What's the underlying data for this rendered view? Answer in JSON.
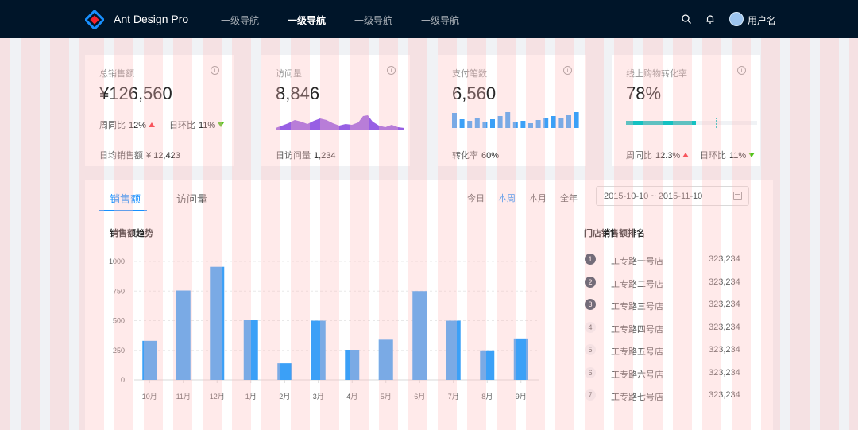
{
  "header": {
    "brand": "Ant Design Pro",
    "nav": [
      {
        "label": "一级导航",
        "active": false
      },
      {
        "label": "一级导航",
        "active": true
      },
      {
        "label": "一级导航",
        "active": false
      },
      {
        "label": "一级导航",
        "active": false
      }
    ],
    "username": "用户名"
  },
  "cards": [
    {
      "title": "总销售额",
      "value": "¥126,560",
      "trend1_label": "周同比",
      "trend1_value": "12%",
      "trend2_label": "日环比",
      "trend2_value": "11%",
      "footer_label": "日均销售额",
      "footer_value": "¥ 12,423"
    },
    {
      "title": "访问量",
      "value": "8,846",
      "footer_label": "日访问量",
      "footer_value": "1,234"
    },
    {
      "title": "支付笔数",
      "value": "6,560",
      "footer_label": "转化率",
      "footer_value": "60%"
    },
    {
      "title": "线上购物转化率",
      "value": "78%",
      "progress": 0.78,
      "trend1_label": "周同比",
      "trend1_value": "12.3%",
      "trend2_label": "日环比",
      "trend2_value": "11%"
    }
  ],
  "tabs": [
    "销售额",
    "访问量"
  ],
  "ranges": [
    "今日",
    "本周",
    "本月",
    "全年"
  ],
  "active_range": "本周",
  "date_range": "2015-10-10 ~ 2015-11-10",
  "chart_data": {
    "type": "bar",
    "title": "销售额趋势",
    "categories": [
      "10月",
      "11月",
      "12月",
      "1月",
      "2月",
      "3月",
      "4月",
      "5月",
      "6月",
      "7月",
      "8月",
      "9月"
    ],
    "values": [
      330,
      755,
      955,
      505,
      140,
      500,
      255,
      340,
      750,
      500,
      250,
      350
    ],
    "ylim": [
      0,
      1000
    ],
    "yticks": [
      0,
      250,
      500,
      750,
      1000
    ],
    "grid": true,
    "color": "#3ba0f7"
  },
  "ranking": {
    "title": "门店销售额排名",
    "items": [
      {
        "rank": "1",
        "name": "工专路一号店",
        "value": "323,234"
      },
      {
        "rank": "2",
        "name": "工专路二号店",
        "value": "323,234"
      },
      {
        "rank": "3",
        "name": "工专路三号店",
        "value": "323,234"
      },
      {
        "rank": "4",
        "name": "工专路四号店",
        "value": "323,234"
      },
      {
        "rank": "5",
        "name": "工专路五号店",
        "value": "323,234"
      },
      {
        "rank": "6",
        "name": "工专路六号店",
        "value": "323,234"
      },
      {
        "rank": "7",
        "name": "工专路七号店",
        "value": "323,234"
      }
    ]
  },
  "mini_bars": [
    0.95,
    0.55,
    0.45,
    0.6,
    0.4,
    0.55,
    0.75,
    1.0,
    0.35,
    0.45,
    0.3,
    0.5,
    0.65,
    0.75,
    0.6,
    0.8,
    1.0
  ],
  "colors": {
    "primary": "#1890ff",
    "header": "#001529",
    "area": "#975fe4",
    "progress": "#13c2c2",
    "up": "#f5222d",
    "down": "#52c41a"
  }
}
